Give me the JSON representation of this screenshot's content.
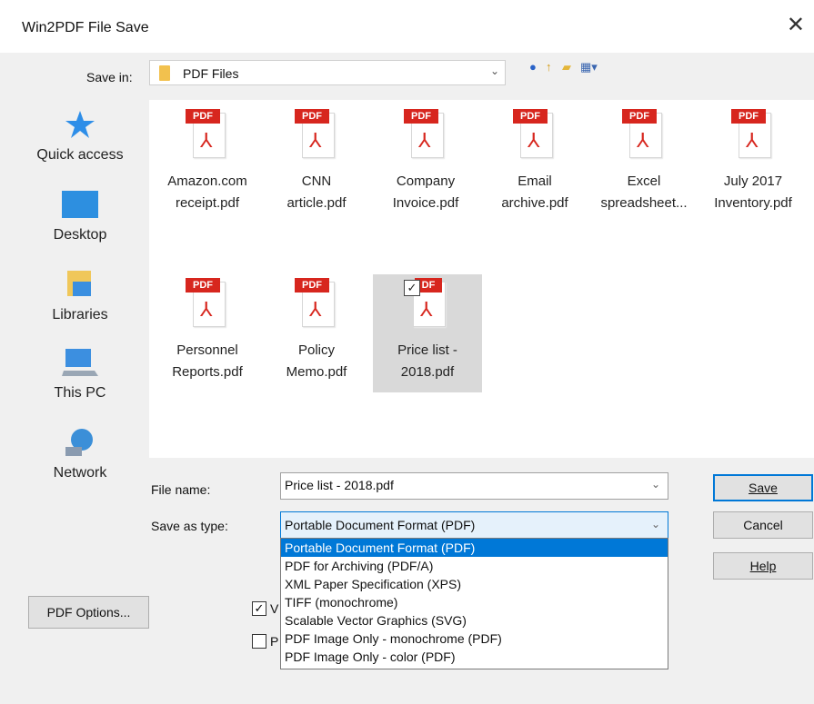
{
  "window": {
    "title": "Win2PDF File Save",
    "close_glyph": "✕"
  },
  "save_in": {
    "label": "Save in:",
    "value": "PDF Files"
  },
  "places": [
    {
      "label": "Quick access",
      "icon": "star-icon"
    },
    {
      "label": "Desktop",
      "icon": "desktop-icon"
    },
    {
      "label": "Libraries",
      "icon": "libraries-icon"
    },
    {
      "label": "This PC",
      "icon": "computer-icon"
    },
    {
      "label": "Network",
      "icon": "network-icon"
    }
  ],
  "files": [
    {
      "line1": "Amazon.com",
      "line2": "receipt.pdf",
      "badge": "PDF"
    },
    {
      "line1": "CNN",
      "line2": "article.pdf",
      "badge": "PDF"
    },
    {
      "line1": "Company",
      "line2": "Invoice.pdf",
      "badge": "PDF"
    },
    {
      "line1": "Email",
      "line2": "archive.pdf",
      "badge": "PDF"
    },
    {
      "line1": "Excel",
      "line2": "spreadsheet...",
      "badge": "PDF"
    },
    {
      "line1": "July 2017",
      "line2": "Inventory.pdf",
      "badge": "PDF"
    },
    {
      "line1": "Personnel",
      "line2": "Reports.pdf",
      "badge": "PDF"
    },
    {
      "line1": "Policy",
      "line2": "Memo.pdf",
      "badge": "PDF"
    },
    {
      "line1": "Price list -",
      "line2": "2018.pdf",
      "badge": "DF",
      "selected": true
    }
  ],
  "file_name": {
    "label": "File name:",
    "value": "Price list - 2018.pdf"
  },
  "save_as_type": {
    "label": "Save as type:",
    "value": "Portable Document Format (PDF)",
    "options": [
      "Portable Document Format (PDF)",
      "PDF for Archiving (PDF/A)",
      "XML Paper Specification (XPS)",
      "TIFF (monochrome)",
      "Scalable Vector Graphics (SVG)",
      "PDF Image Only - monochrome (PDF)",
      "PDF Image Only - color (PDF)"
    ]
  },
  "buttons": {
    "save": "Save",
    "cancel": "Cancel",
    "help": "Help",
    "pdf_options": "PDF Options..."
  },
  "checkboxes": [
    {
      "text": "V",
      "checked": true
    },
    {
      "text": "P",
      "checked": false
    }
  ],
  "colors": {
    "accent": "#0078d7",
    "pdf_red": "#d7261e"
  }
}
